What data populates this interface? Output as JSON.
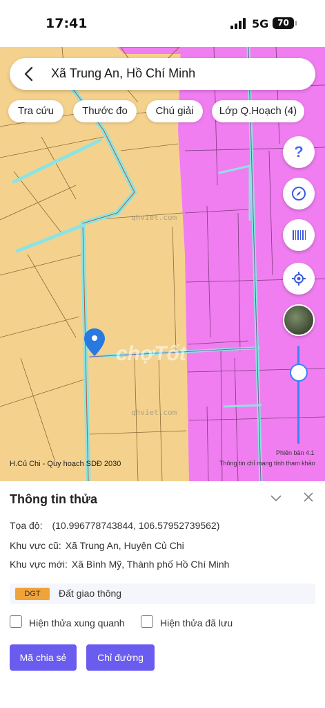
{
  "status_bar": {
    "time": "17:41",
    "network": "5G",
    "battery": "70"
  },
  "search": {
    "title": "Xã Trung An, Hồ Chí Minh"
  },
  "chips": [
    {
      "label": "Tra cứu"
    },
    {
      "label": "Thước đo"
    },
    {
      "label": "Chú giải"
    },
    {
      "label": "Lớp Q.Hoạch (4)"
    }
  ],
  "map": {
    "help_label": "?",
    "caption": "H.Củ Chi - Quy hoạch SDĐ 2030",
    "version": "Phiên bản 4.1",
    "note": "Thông tin chỉ mang tính tham khảo",
    "watermark_site": "qhviet.com",
    "watermark_brand": "chợTốt",
    "colors": {
      "residential": "#f4d28d",
      "planned": "#f07ef0",
      "road": "#8de3e3",
      "marker": "#2979e0"
    }
  },
  "sheet": {
    "title": "Thông tin thửa",
    "coords_label": "Tọa độ:",
    "coords_value": "(10.996778743844, 106.57952739562)",
    "old_area_label": "Khu vực cũ:",
    "old_area_value": "Xã Trung An, Huyện Củ Chi",
    "new_area_label": "Khu vực mới:",
    "new_area_value": "Xã Bình Mỹ, Thành phố Hồ Chí Minh",
    "land_code": "DGT",
    "land_name": "Đất giao thông",
    "checkbox_nearby": "Hiện thửa xung quanh",
    "checkbox_saved": "Hiện thửa đã lưu",
    "share_button": "Mã chia sẻ",
    "directions_button": "Chỉ đường"
  }
}
